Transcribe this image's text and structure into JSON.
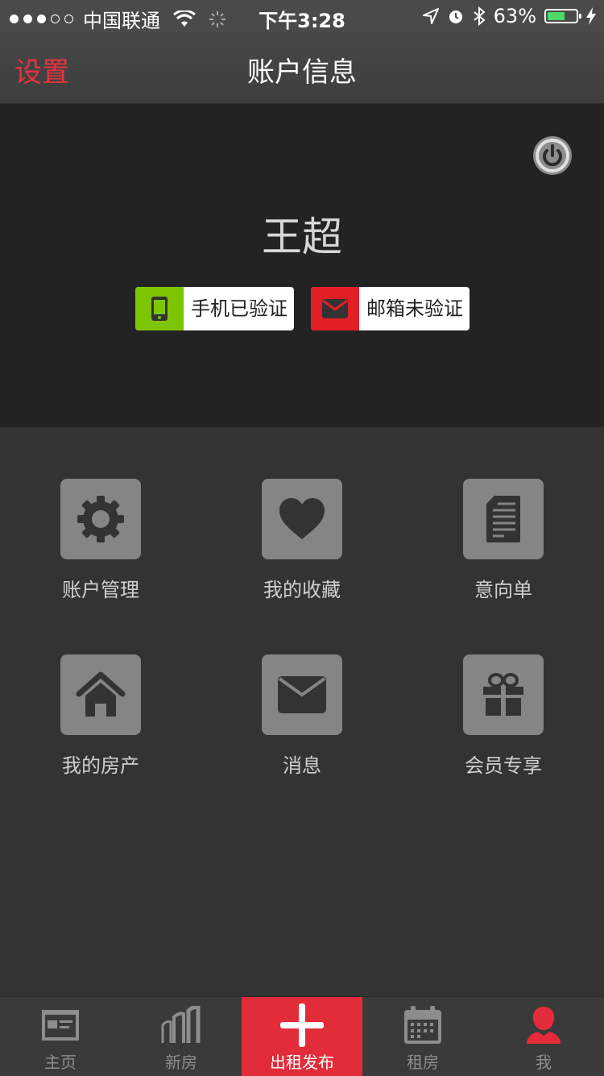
{
  "status": {
    "carrier": "中国联通",
    "time": "下午3:28",
    "battery_pct": "63%",
    "battery_level": 0.63,
    "signal_bars": 3,
    "signal_total": 5
  },
  "nav": {
    "back_label": "设置",
    "title": "账户信息"
  },
  "profile": {
    "name": "王超",
    "phone_badge": "手机已验证",
    "email_badge": "邮箱未验证",
    "phone_color": "#7ec501",
    "email_color": "#e41e25"
  },
  "menu": [
    {
      "label": "账户管理",
      "icon": "gear-icon"
    },
    {
      "label": "我的收藏",
      "icon": "heart-icon"
    },
    {
      "label": "意向单",
      "icon": "document-icon"
    },
    {
      "label": "我的房产",
      "icon": "house-icon"
    },
    {
      "label": "消息",
      "icon": "envelope-icon"
    },
    {
      "label": "会员专享",
      "icon": "gift-icon"
    }
  ],
  "tabs": [
    {
      "label": "主页",
      "icon": "newspaper-icon"
    },
    {
      "label": "新房",
      "icon": "buildings-icon"
    },
    {
      "label": "出租发布",
      "icon": "plus-icon"
    },
    {
      "label": "租房",
      "icon": "calendar-icon"
    },
    {
      "label": "我",
      "icon": "person-icon"
    }
  ],
  "colors": {
    "accent": "#e32c3a",
    "tile": "#858585"
  }
}
